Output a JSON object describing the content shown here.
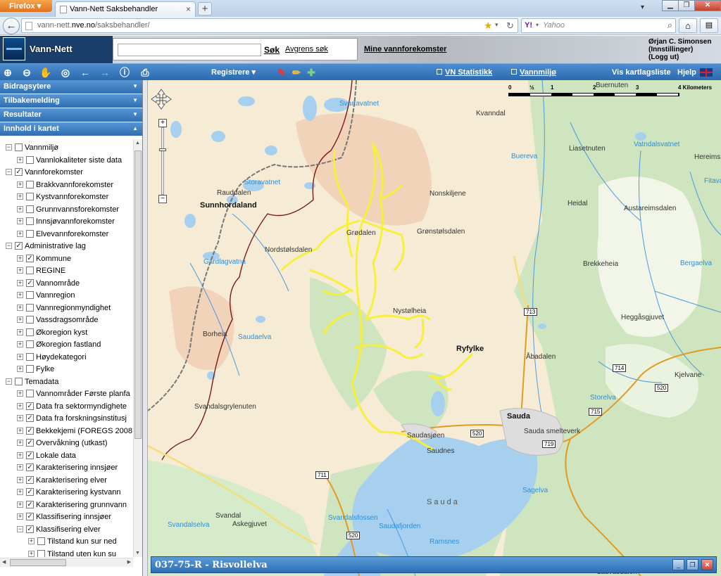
{
  "browser": {
    "app_button": "Firefox",
    "tab_title": "Vann-Nett Saksbehandler",
    "tab_close": "×",
    "new_tab": "+",
    "url_prefix": "vann-nett.",
    "url_domain": "nve.no",
    "url_path": "/saksbehandler/",
    "search_engine": "Y!",
    "search_placeholder": "Yahoo"
  },
  "header": {
    "app_title": "Vann-Nett",
    "search_placeholder": "",
    "sok_label": "Søk",
    "avgrens_label": "Avgrens søk",
    "mine_label": "Mine vannforekomster",
    "user_name": "Ørjan C. Simonsen",
    "user_settings": "(Innstillinger)",
    "user_logout": "(Logg ut)"
  },
  "toolbar": {
    "registrere_label": "Registrere",
    "vn_statistikk": "VN Statistikk",
    "vannmiljo": "Vannmiljø",
    "vis_kartlagsliste": "Vis kartlagsliste",
    "hjelp": "Hjelp"
  },
  "sidebar": {
    "sections": [
      {
        "label": "Bidragsytere"
      },
      {
        "label": "Tilbakemelding"
      },
      {
        "label": "Resultater"
      },
      {
        "label": "Innhold i kartet"
      }
    ],
    "tree": [
      {
        "label": "Vannmiljø",
        "level": 0,
        "exp": "−",
        "checked": false
      },
      {
        "label": "Vannlokaliteter siste data",
        "level": 1,
        "exp": "+",
        "checked": false
      },
      {
        "label": "Vannforekomster",
        "level": 0,
        "exp": "−",
        "checked": true
      },
      {
        "label": "Brakkvannforekomster",
        "level": 1,
        "exp": "+",
        "checked": false
      },
      {
        "label": "Kystvannforekomster",
        "level": 1,
        "exp": "+",
        "checked": false
      },
      {
        "label": "Grunnvannsforekomster",
        "level": 1,
        "exp": "+",
        "checked": false
      },
      {
        "label": "Innsjøvannforekomster",
        "level": 1,
        "exp": "+",
        "checked": false
      },
      {
        "label": "Elvevannforekomster",
        "level": 1,
        "exp": "+",
        "checked": false
      },
      {
        "label": "Administrative lag",
        "level": 0,
        "exp": "−",
        "checked": true
      },
      {
        "label": "Kommune",
        "level": 1,
        "exp": "+",
        "checked": true
      },
      {
        "label": "REGINE",
        "level": 1,
        "exp": "+",
        "checked": false
      },
      {
        "label": "Vannområde",
        "level": 1,
        "exp": "+",
        "checked": true
      },
      {
        "label": "Vannregion",
        "level": 1,
        "exp": "+",
        "checked": false
      },
      {
        "label": "Vannregionmyndighet",
        "level": 1,
        "exp": "+",
        "checked": false
      },
      {
        "label": "Vassdragsområde",
        "level": 1,
        "exp": "+",
        "checked": false
      },
      {
        "label": "Økoregion kyst",
        "level": 1,
        "exp": "+",
        "checked": false
      },
      {
        "label": "Økoregion fastland",
        "level": 1,
        "exp": "+",
        "checked": false
      },
      {
        "label": "Høydekategori",
        "level": 1,
        "exp": "+",
        "checked": false
      },
      {
        "label": "Fylke",
        "level": 1,
        "exp": "+",
        "checked": false
      },
      {
        "label": "Temadata",
        "level": 0,
        "exp": "−",
        "checked": false
      },
      {
        "label": "Vannområder Første planfa",
        "level": 1,
        "exp": "+",
        "checked": false
      },
      {
        "label": "Data fra sektormyndighete",
        "level": 1,
        "exp": "+",
        "checked": true
      },
      {
        "label": "Data fra forskningsinstitusj",
        "level": 1,
        "exp": "+",
        "checked": true
      },
      {
        "label": "Bekkekjemi (FOREGS 2008",
        "level": 1,
        "exp": "+",
        "checked": true
      },
      {
        "label": "Overvåkning (utkast)",
        "level": 1,
        "exp": "+",
        "checked": true
      },
      {
        "label": "Lokale data",
        "level": 1,
        "exp": "+",
        "checked": true
      },
      {
        "label": "Karakterisering innsjøer",
        "level": 1,
        "exp": "+",
        "checked": true
      },
      {
        "label": "Karakterisering elver",
        "level": 1,
        "exp": "+",
        "checked": true
      },
      {
        "label": "Karakterisering kystvann",
        "level": 1,
        "exp": "+",
        "checked": true
      },
      {
        "label": "Karakterisering grunnvann",
        "level": 1,
        "exp": "+",
        "checked": true
      },
      {
        "label": "Klassifisering innsjøer",
        "level": 1,
        "exp": "+",
        "checked": true
      },
      {
        "label": "Klassifisering elver",
        "level": 1,
        "exp": "−",
        "checked": true
      },
      {
        "label": "Tilstand kun sur ned",
        "level": 2,
        "exp": "+",
        "checked": false
      },
      {
        "label": "Tilstand uten kun su",
        "level": 2,
        "exp": "+",
        "checked": false
      }
    ]
  },
  "map": {
    "scale_labels": [
      "0",
      "½",
      "1",
      "2",
      "3",
      "4 Kilometers"
    ],
    "place_labels": {
      "svartavatnet": "Svartavatnet",
      "kvanndal": "Kvanndal",
      "buernuten": "Buernuten",
      "buereva": "Buereva",
      "liasetnuten": "Liasetnuten",
      "vatndalsvatnet": "Vatndalsvatnet",
      "hereims": "Hereims",
      "fitava": "Fitava",
      "rauddalen": "Rauddalen",
      "storavatnet": "Storavatnet",
      "sunnhordaland": "Sunnhordaland",
      "nonskiljene": "Nonskiljene",
      "heidal": "Heidal",
      "austareimsdalen": "Austareimsdalen",
      "gardalen": "Grødalen",
      "gronstolsdalen": "Grønstølsdalen",
      "nordstolsdalen": "Nordstølsdalen",
      "gardlagvatna": "Gardlagvatna",
      "brekkeheia": "Brekkeheia",
      "bergaelva": "Bergaelva",
      "nystolheia": "Nystølheia",
      "heggasgjuvet": "Heggåsgjuvet",
      "borheia": "Borheia",
      "saudaelva": "Saudaelva",
      "ryfylke": "Ryfylke",
      "abadalen": "Åbadalen",
      "kjelvane": "Kjelvane",
      "storelva": "Storelva",
      "svandalsgrylenuten": "Svandalsgrylenuten",
      "sauda": "Sauda",
      "saudasjoen": "Saudasjøen",
      "saudnes": "Saudnes",
      "sauda_smelteverk": "Sauda smelteverk",
      "sagelva": "Sagelva",
      "sauda_fjord": "Sauda",
      "svandal": "Svandal",
      "askegjuvet": "Askegjuvet",
      "svandalselva": "Svandalselva",
      "svandalsfossen": "Svandalsfossen",
      "saudafjorden": "Saudafjorden",
      "ramsnes": "Ramsnes",
      "lauvasdalen": "Lauvasdalen"
    },
    "road_numbers": {
      "r713": "713",
      "r714": "714",
      "r520a": "520",
      "r715": "715",
      "r719": "719",
      "r520b": "520",
      "r711": "711",
      "r520c": "520"
    }
  },
  "bottom_panel": {
    "title": "037-75-R - Risvollelva"
  }
}
